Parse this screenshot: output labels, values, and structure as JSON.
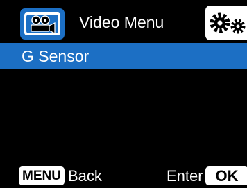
{
  "header": {
    "title": "Video Menu",
    "mode_icon": "video-camera-icon",
    "settings_icon": "gears-icon"
  },
  "colors": {
    "accent": "#1c6fc4",
    "background": "#000000",
    "text": "#ffffff"
  },
  "menu": {
    "items": [
      {
        "label": "G Sensor",
        "selected": true
      }
    ]
  },
  "footer": {
    "menu_key": "MENU",
    "menu_action": "Back",
    "ok_action": "Enter",
    "ok_key": "OK"
  }
}
